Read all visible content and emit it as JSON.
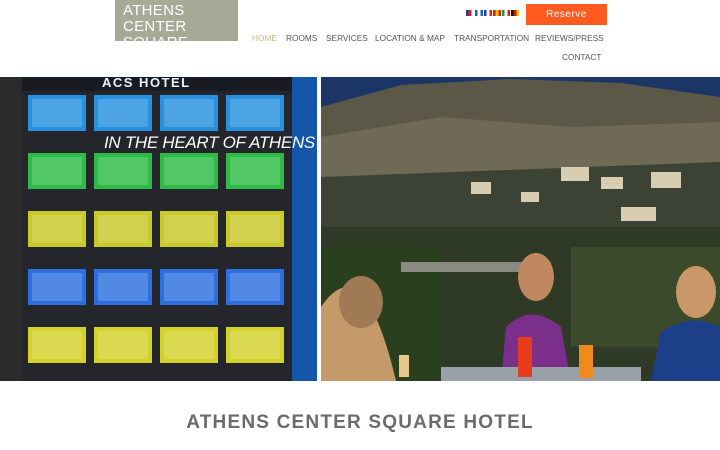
{
  "logo": {
    "line1": "Athens Center",
    "line2": "Square Hotel"
  },
  "languages": [
    {
      "code": "en",
      "colors": [
        "#2b3a8f",
        "#d22",
        "#fff"
      ]
    },
    {
      "code": "gr",
      "colors": [
        "#1f5fb5",
        "#fff",
        "#1f5fb5"
      ]
    },
    {
      "code": "fr",
      "colors": [
        "#1f3fa8",
        "#fff",
        "#d22"
      ]
    },
    {
      "code": "es",
      "colors": [
        "#c21",
        "#f2c200",
        "#c21"
      ]
    },
    {
      "code": "it",
      "colors": [
        "#1a9a3a",
        "#fff",
        "#d22"
      ]
    },
    {
      "code": "de",
      "colors": [
        "#111",
        "#d11",
        "#f2c200"
      ]
    }
  ],
  "reserve_label": "Reserve",
  "nav": [
    {
      "id": "home",
      "label": "Home",
      "active": true
    },
    {
      "id": "rooms",
      "label": "Rooms",
      "active": false
    },
    {
      "id": "services",
      "label": "Services",
      "active": false
    },
    {
      "id": "location",
      "label": "Location & Map",
      "active": false
    },
    {
      "id": "transportation",
      "label": "Transportation",
      "active": false
    },
    {
      "id": "reviews",
      "label": "Reviews/Press",
      "active": false
    },
    {
      "id": "contact",
      "label": "Contact",
      "active": false
    }
  ],
  "hero": {
    "building_sign": "ACS HOTEL",
    "tagline": "In the heart of Athens"
  },
  "heading": "Athens Center Square Hotel",
  "colors": {
    "accent": "#ff5a1f",
    "logo_bg": "#a8aa98",
    "nav_active": "#c8b97a"
  }
}
